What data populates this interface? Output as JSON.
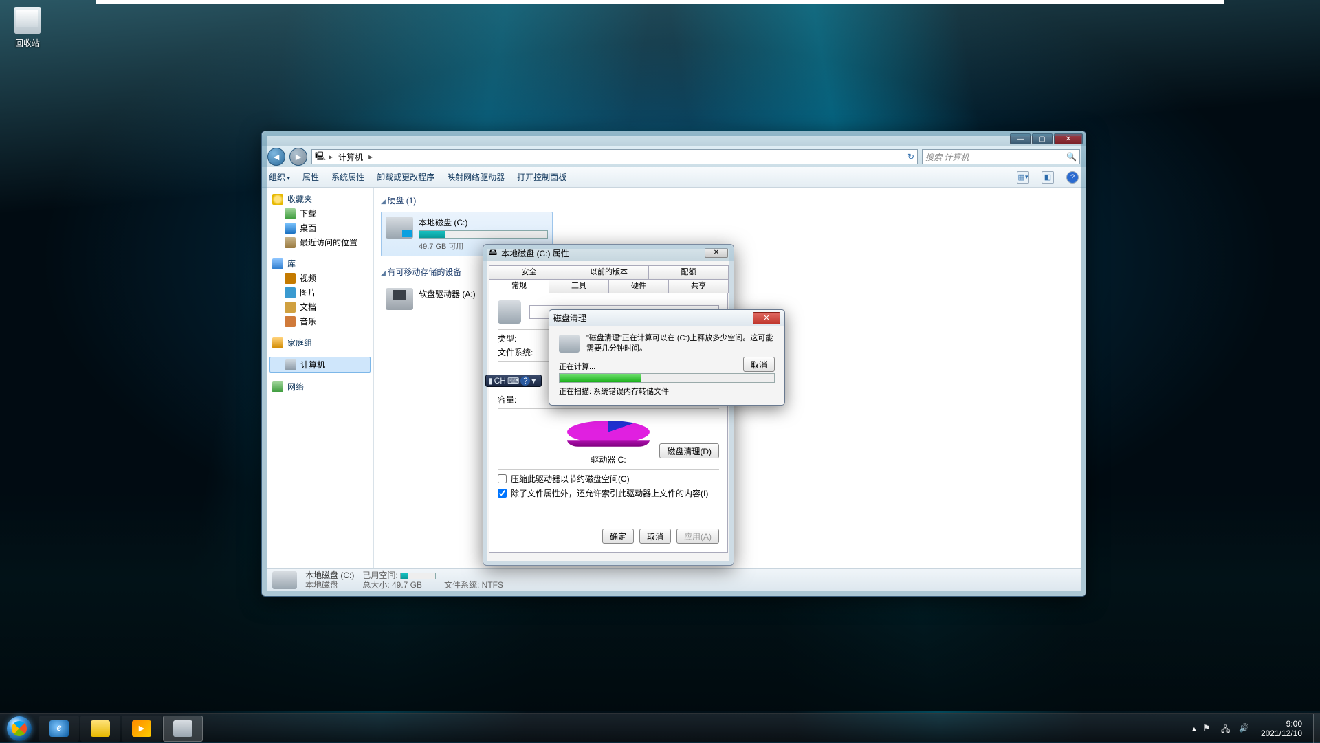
{
  "desktop": {
    "recycle_bin": "回收站"
  },
  "explorer": {
    "breadcrumb_root": "计算机",
    "search_placeholder": "搜索 计算机",
    "toolbar": {
      "organize": "组织",
      "properties": "属性",
      "sys_properties": "系统属性",
      "uninstall": "卸载或更改程序",
      "map_drive": "映射网络驱动器",
      "control_panel": "打开控制面板"
    },
    "sidebar": {
      "favorites": "收藏夹",
      "downloads": "下载",
      "desktop": "桌面",
      "recent": "最近访问的位置",
      "libraries": "库",
      "videos": "视频",
      "pictures": "图片",
      "documents": "文档",
      "music": "音乐",
      "homegroup": "家庭组",
      "computer": "计算机",
      "network": "网络"
    },
    "groups": {
      "hdd": "硬盘 (1)",
      "removable": "有可移动存储的设备"
    },
    "drive": {
      "name": "本地磁盘 (C:)",
      "free_line": "49.7 GB 可用"
    },
    "floppy": {
      "name": "软盘驱动器 (A:)"
    },
    "status": {
      "name": "本地磁盘 (C:)",
      "sub": "本地磁盘",
      "used_lab": "已用空间:",
      "total_lab": "总大小: 49.7 GB",
      "fs_lab": "文件系统: NTFS"
    }
  },
  "props": {
    "title": "本地磁盘 (C:) 属性",
    "tabs": {
      "security": "安全",
      "prev": "以前的版本",
      "quota": "配额",
      "general": "常规",
      "tools": "工具",
      "hardware": "硬件",
      "sharing": "共享"
    },
    "type_lab": "类型:",
    "fs_lab": "文件系统:",
    "cap_lab": "容量:",
    "drive_caption": "驱动器 C:",
    "cleanup_btn": "磁盘清理(D)",
    "compress": "压缩此驱动器以节约磁盘空间(C)",
    "index": "除了文件属性外，还允许索引此驱动器上文件的内容(I)",
    "ok": "确定",
    "cancel": "取消",
    "apply": "应用(A)"
  },
  "cleanup": {
    "title": "磁盘清理",
    "msg": "\"磁盘清理\"正在计算可以在 (C:)上释放多少空间。这可能需要几分钟时间。",
    "calc": "正在计算...",
    "scan": "正在扫描:  系统错误内存转储文件",
    "cancel": "取消"
  },
  "ime": {
    "lang": "CH"
  },
  "tray": {
    "time": "9:00",
    "date": "2021/12/10"
  }
}
